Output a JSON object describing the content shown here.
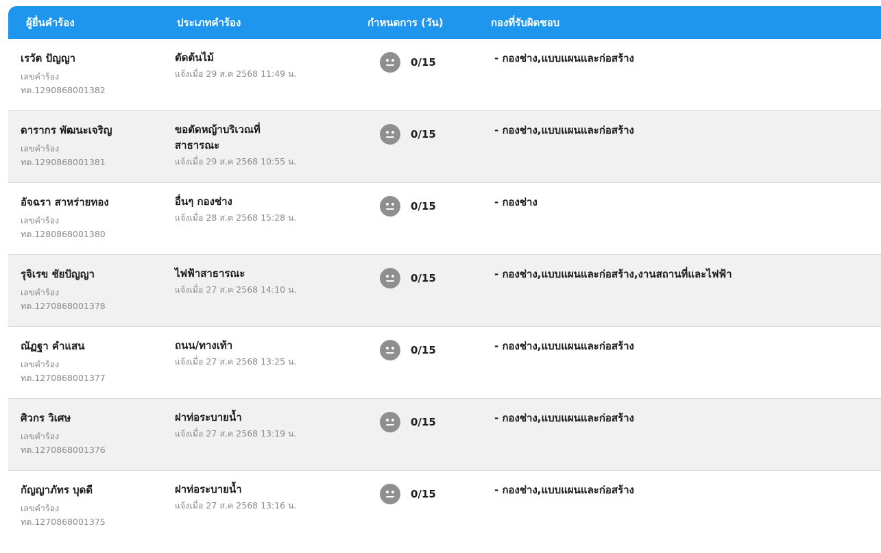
{
  "header": {
    "requester": "ผู้ยื่นคำร้อง",
    "request_type": "ประเภทคำร้อง",
    "deadline": "กำหนดการ (วัน)",
    "department": "กองที่รับผิดชอบ"
  },
  "colors": {
    "header_bg": "#1e96ee",
    "row_alt_bg": "#f1f1f1",
    "status_icon": "#8f8f8f"
  },
  "status_icon_name": "neutral-face-icon",
  "rows": [
    {
      "name": "เรวัต ปัญญา",
      "id_label": "เลขคำร้อง",
      "id": "ทต.1290868001382",
      "type": "ตัดต้นไม้",
      "reported": "แจ้งเมื่อ 29 ส.ค 2568 11:49 น.",
      "progress": "0/15",
      "department": "- กองช่าง,แบบแผนและก่อสร้าง"
    },
    {
      "name": "ดารากร พัฒนะเจริญ",
      "id_label": "เลขคำร้อง",
      "id": "ทต.1290868001381",
      "type": "ขอตัดหญ้าบริเวณที่สาธารณะ",
      "reported": "แจ้งเมื่อ 29 ส.ค 2568 10:55 น.",
      "progress": "0/15",
      "department": "- กองช่าง,แบบแผนและก่อสร้าง"
    },
    {
      "name": "อัจฉรา สาหร่ายทอง",
      "id_label": "เลขคำร้อง",
      "id": "ทต.1280868001380",
      "type": "อื่นๆ กองช่าง",
      "reported": "แจ้งเมื่อ 28 ส.ค 2568 15:28 น.",
      "progress": "0/15",
      "department": "- กองช่าง"
    },
    {
      "name": "รุจิเรข ชัยปัญญา",
      "id_label": "เลขคำร้อง",
      "id": "ทต.1270868001378",
      "type": "ไฟฟ้าสาธารณะ",
      "reported": "แจ้งเมื่อ 27 ส.ค 2568 14:10 น.",
      "progress": "0/15",
      "department": "- กองช่าง,แบบแผนและก่อสร้าง,งานสถานที่และไฟฟ้า"
    },
    {
      "name": "ณัฏฐา คำแสน",
      "id_label": "เลขคำร้อง",
      "id": "ทต.1270868001377",
      "type": "ถนน/ทางเท้า",
      "reported": "แจ้งเมื่อ 27 ส.ค 2568 13:25 น.",
      "progress": "0/15",
      "department": "- กองช่าง,แบบแผนและก่อสร้าง"
    },
    {
      "name": "ศิวกร วิเศษ",
      "id_label": "เลขคำร้อง",
      "id": "ทต.1270868001376",
      "type": "ฝาท่อระบายน้ำ",
      "reported": "แจ้งเมื่อ 27 ส.ค 2568 13:19 น.",
      "progress": "0/15",
      "department": "- กองช่าง,แบบแผนและก่อสร้าง"
    },
    {
      "name": "กัญญาภัทร บุดดี",
      "id_label": "เลขคำร้อง",
      "id": "ทต.1270868001375",
      "type": "ฝาท่อระบายน้ำ",
      "reported": "แจ้งเมื่อ 27 ส.ค 2568 13:16 น.",
      "progress": "0/15",
      "department": "- กองช่าง,แบบแผนและก่อสร้าง"
    }
  ]
}
